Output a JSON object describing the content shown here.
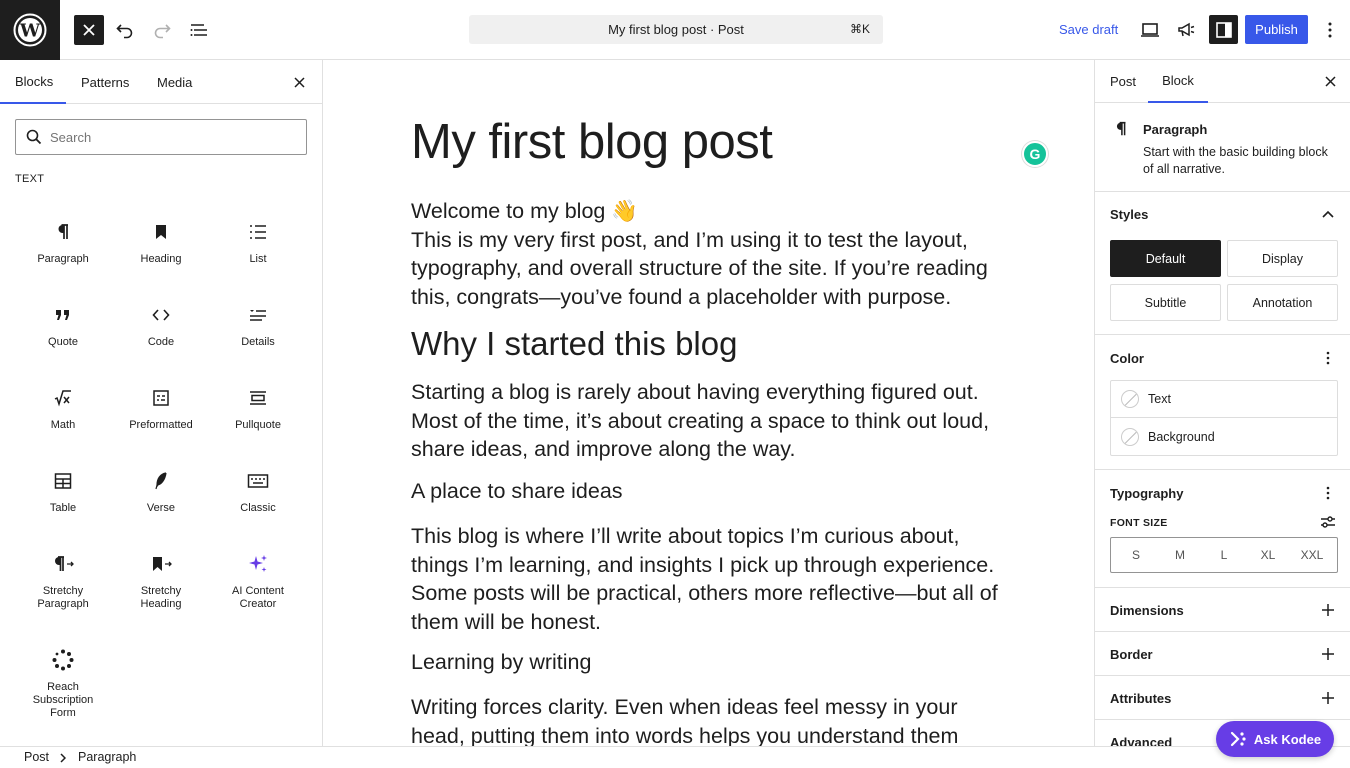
{
  "topbar": {
    "command_title": "My first blog post · Post",
    "command_shortcut": "⌘K",
    "save_draft": "Save draft",
    "publish": "Publish"
  },
  "inserter": {
    "tabs": [
      "Blocks",
      "Patterns",
      "Media"
    ],
    "search_placeholder": "Search",
    "category": "TEXT",
    "blocks": [
      {
        "label": "Paragraph",
        "icon": "paragraph-icon"
      },
      {
        "label": "Heading",
        "icon": "heading-icon"
      },
      {
        "label": "List",
        "icon": "list-icon"
      },
      {
        "label": "Quote",
        "icon": "quote-icon"
      },
      {
        "label": "Code",
        "icon": "code-icon"
      },
      {
        "label": "Details",
        "icon": "details-icon"
      },
      {
        "label": "Math",
        "icon": "math-icon"
      },
      {
        "label": "Preformatted",
        "icon": "preformatted-icon"
      },
      {
        "label": "Pullquote",
        "icon": "pullquote-icon"
      },
      {
        "label": "Table",
        "icon": "table-icon"
      },
      {
        "label": "Verse",
        "icon": "verse-icon"
      },
      {
        "label": "Classic",
        "icon": "classic-icon"
      },
      {
        "label": "Stretchy\nParagraph",
        "icon": "stretchy-paragraph-icon"
      },
      {
        "label": "Stretchy\nHeading",
        "icon": "stretchy-heading-icon"
      },
      {
        "label": "AI Content\nCreator",
        "icon": "sparkles-icon"
      },
      {
        "label": "Reach\nSubscription\nForm",
        "icon": "subscription-icon"
      }
    ]
  },
  "post": {
    "title": "My first blog post",
    "intro": "Welcome to my blog 👋\nThis is my very first post, and I’m using it to test the layout, typography, and overall structure of the site. If you’re reading this, congrats—you’ve found a placeholder with purpose.",
    "heading1": "Why I started this blog",
    "para2": "Starting a blog is rarely about having everything figured out. Most of the time, it’s about creating a space to think out loud, share ideas, and improve along the way.",
    "heading2": "A place to share ideas",
    "para3": "This blog is where I’ll write about topics I’m curious about, things I’m learning, and insights I pick up through experience. Some posts will be practical, others more reflective—but all of them will be honest.",
    "heading3": "Learning by writing",
    "para4": "Writing forces clarity. Even when ideas feel messy in your head, putting them into words helps you understand them better. This"
  },
  "sidebar": {
    "tabs": [
      "Post",
      "Block"
    ],
    "block_name": "Paragraph",
    "block_desc": "Start with the basic building block of all narrative.",
    "styles_title": "Styles",
    "styles": [
      "Default",
      "Display",
      "Subtitle",
      "Annotation"
    ],
    "color_title": "Color",
    "colors": [
      "Text",
      "Background"
    ],
    "typography_title": "Typography",
    "font_size_label": "FONT SIZE",
    "font_sizes": [
      "S",
      "M",
      "L",
      "XL",
      "XXL"
    ],
    "dimensions": "Dimensions",
    "border": "Border",
    "attributes": "Attributes",
    "advanced": "Advanced"
  },
  "footer": {
    "crumbs": [
      "Post",
      "Paragraph"
    ]
  },
  "kodee": "Ask Kodee",
  "colors": {
    "accent": "#3858e9",
    "dark": "#1e1e1e",
    "kodee": "#673de6"
  }
}
